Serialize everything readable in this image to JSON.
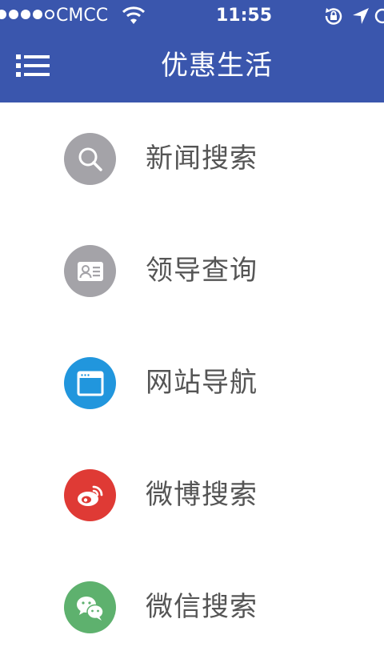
{
  "status_bar": {
    "carrier": "CMCC",
    "time": "11:55"
  },
  "header": {
    "title": "优惠生活",
    "background": "#3a56ad"
  },
  "items": [
    {
      "label": "新闻搜索",
      "icon": "search-icon",
      "color": "#a4a3a8"
    },
    {
      "label": "领导查询",
      "icon": "id-card-icon",
      "color": "#a4a3a8"
    },
    {
      "label": "网站导航",
      "icon": "browser-window-icon",
      "color": "#2196dd"
    },
    {
      "label": "微博搜索",
      "icon": "weibo-icon",
      "color": "#df3a35"
    },
    {
      "label": "微信搜索",
      "icon": "wechat-icon",
      "color": "#5eb16e"
    }
  ]
}
